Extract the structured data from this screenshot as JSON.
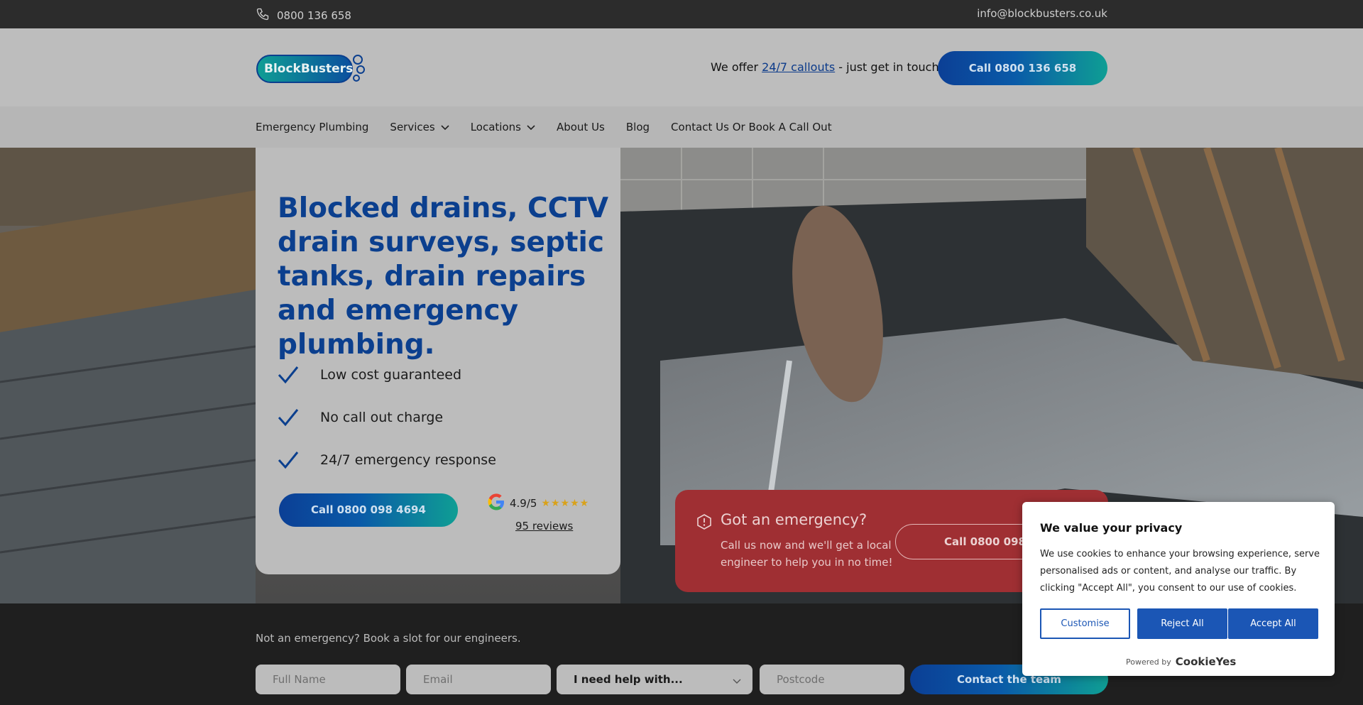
{
  "topbar": {
    "phone": "0800 136 658",
    "email": "info@blockbusters.co.uk",
    "icon": "phone-icon"
  },
  "header": {
    "logo_text": "BlockBusters",
    "offer_prefix": "We offer ",
    "offer_link": "24/7 callouts",
    "offer_suffix": " - just get in touch!",
    "call_button": "Call 0800 136 658"
  },
  "nav": {
    "items": [
      {
        "label": "Emergency Plumbing"
      },
      {
        "label": "Services"
      },
      {
        "label": "Locations"
      },
      {
        "label": "About Us"
      },
      {
        "label": "Blog"
      },
      {
        "label": "Contact Us Or Book A Call Out"
      }
    ]
  },
  "hero": {
    "title": "Blocked drains, CCTV drain surveys, septic tanks, drain repairs and emergency plumbing.",
    "features": [
      "Low cost guaranteed",
      "No call out charge",
      "24/7 emergency response"
    ],
    "call_button": "Call 0800 098 4694",
    "rating": {
      "value": "4.9/5",
      "stars": "★★★★★",
      "reviews": "95 reviews"
    }
  },
  "emergency": {
    "title": "Got an emergency?",
    "text": "Call us now and we'll get a local engineer to help you in no time!",
    "button": "Call 0800 098 4694"
  },
  "booking": {
    "lead": "Not an emergency? Book a slot for our engineers.",
    "name_placeholder": "Full Name",
    "email_placeholder": "Email",
    "help_select": "I need help with...",
    "postcode_placeholder": "Postcode",
    "submit": "Contact the team"
  },
  "cookie": {
    "title": "We value your privacy",
    "text": "We use cookies to enhance your browsing experience, serve personalised ads or content, and analyse our traffic. By clicking \"Accept All\", you consent to our use of cookies.",
    "customise": "Customise",
    "reject": "Reject All",
    "accept": "Accept All",
    "powered_by": "Powered by",
    "brand": "CookieYes"
  },
  "colors": {
    "brand_blue": "#0b3f8e",
    "teal": "#0f9e94",
    "emergency_red": "#9f2f33",
    "cookie_blue": "#1b56b5"
  }
}
